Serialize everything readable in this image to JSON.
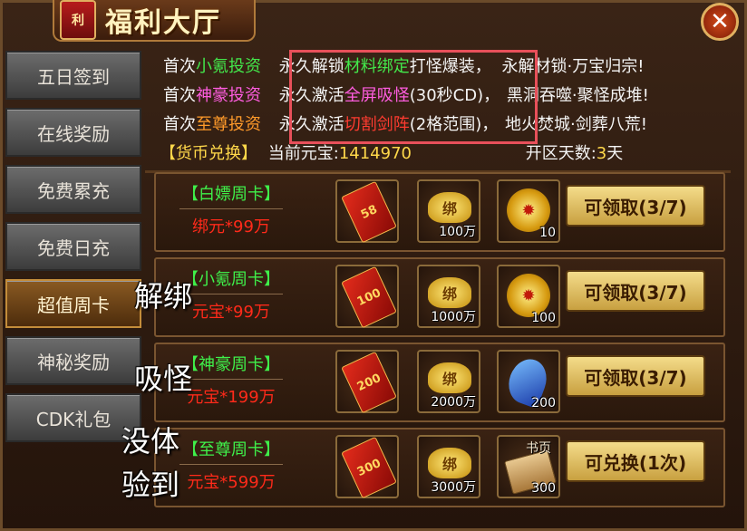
{
  "title": {
    "seal": "利",
    "text": "福利大厅"
  },
  "close_icon": "close-x-icon",
  "sidebar": {
    "items": [
      {
        "label": "五日签到",
        "active": false
      },
      {
        "label": "在线奖励",
        "active": false
      },
      {
        "label": "免费累充",
        "active": false
      },
      {
        "label": "免费日充",
        "active": false
      },
      {
        "label": "超值周卡",
        "active": true
      },
      {
        "label": "神秘奖励",
        "active": false
      },
      {
        "label": "CDK礼包",
        "active": false
      }
    ]
  },
  "info": {
    "rows": [
      {
        "prefix": "首次",
        "name": "小氪投资",
        "effect_a": "永久解锁",
        "effect_b": "材料绑定",
        "effect_c": "打怪爆装，",
        "tagline": "永解材锁·万宝归宗!"
      },
      {
        "prefix": "首次",
        "name": "神豪投资",
        "effect_a": "永久激活",
        "effect_b": "全屏吸怪",
        "effect_c": "(30秒CD)，",
        "tagline": "黑洞吞噬·聚怪成堆!"
      },
      {
        "prefix": "首次",
        "name": "至尊投资",
        "effect_a": "永久激活",
        "effect_b": "切割剑阵",
        "effect_c": "(2格范围)，",
        "tagline": "地火焚城·剑葬八荒!"
      }
    ],
    "exchange_label": "【货币兑换】",
    "current_label": "当前元宝:",
    "current_value": "1414970",
    "days_label": "开区天数:",
    "days_value": "3",
    "days_unit": "天"
  },
  "cards": [
    {
      "name": "【白嫖周卡】",
      "price": "绑元*99万",
      "envelope": "58",
      "ingot_label": "绑",
      "ingot_qty": "100万",
      "third_icon": "gold-coin-icon",
      "third_qty": "10",
      "button": "可领取(3/7)"
    },
    {
      "name": "【小氪周卡】",
      "price": "元宝*99万",
      "envelope": "100",
      "ingot_label": "绑",
      "ingot_qty": "1000万",
      "third_icon": "gold-coin-icon",
      "third_qty": "100",
      "button": "可领取(3/7)"
    },
    {
      "name": "【神豪周卡】",
      "price": "元宝*199万",
      "envelope": "200",
      "ingot_label": "绑",
      "ingot_qty": "2000万",
      "third_icon": "blue-gem-icon",
      "third_qty": "200",
      "button": "可领取(3/7)"
    },
    {
      "name": "【至尊周卡】",
      "price": "元宝*599万",
      "envelope": "300",
      "ingot_label": "绑",
      "ingot_qty": "3000万",
      "third_icon": "book-page-icon",
      "third_tag": "书页",
      "third_qty": "300",
      "button": "可兑换(1次)"
    }
  ],
  "overlay": {
    "line1": "解绑",
    "line2": "吸怪",
    "line3": "没体",
    "line4": "验到"
  },
  "colors": {
    "green": "#43e84b",
    "pink": "#ff5de0",
    "orange": "#ff9a2a",
    "highlight_border": "#e8505a",
    "price_red": "#ff2a1a"
  }
}
